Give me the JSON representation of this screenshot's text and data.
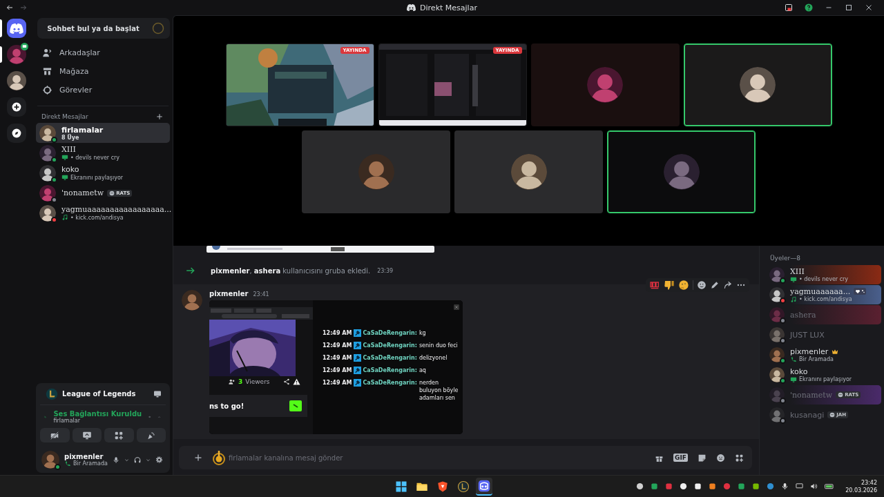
{
  "window": {
    "title": "Direkt Mesajlar"
  },
  "servers": [
    {
      "kind": "home",
      "selected": true,
      "unread": false,
      "in_call": false
    },
    {
      "kind": "avatar",
      "selected": false,
      "unread": true,
      "in_call": true
    },
    {
      "kind": "avatar",
      "selected": false,
      "unread": false,
      "in_call": false
    },
    {
      "kind": "add"
    },
    {
      "kind": "explore"
    }
  ],
  "dm_sidebar": {
    "search": "Sohbet bul ya da başlat",
    "nav": [
      {
        "kind": "friends",
        "label": "Arkadaşlar"
      },
      {
        "kind": "store",
        "label": "Mağaza"
      },
      {
        "kind": "quests",
        "label": "Görevler"
      }
    ],
    "section": "Direkt Mesajlar",
    "dms": [
      {
        "name": "firlamalar",
        "fancy": false,
        "sub": {
          "kind": "plain",
          "text": "8 Üye"
        },
        "selected": true,
        "color": "#23a55a"
      },
      {
        "name": "XIII",
        "fancy": true,
        "sub": {
          "kind": "screen",
          "text": "• devils never cry"
        },
        "selected": false,
        "color": "#23a55a"
      },
      {
        "name": "koko",
        "fancy": false,
        "sub": {
          "kind": "screen",
          "text": "Ekranını paylaşıyor"
        },
        "selected": false,
        "color": "#23a55a"
      },
      {
        "name": "'nonametw",
        "fancy": true,
        "tag": "RATS",
        "selected": false,
        "color": "#80848e"
      },
      {
        "name": "yagmuaaaaaaaaaaaaaaaaa...",
        "fancy": true,
        "sub": {
          "kind": "music",
          "text": "• kick.com/andisya"
        },
        "selected": false,
        "color": "#f23f43"
      }
    ]
  },
  "user_panel": {
    "activity": "League of Legends",
    "voice_status": "Ses Bağlantısı Kuruldu",
    "voice_channel": "firlamalar",
    "user": "pixmenler",
    "user_status": "Bir Aramada"
  },
  "call": {
    "rows": [
      [
        {
          "kind": "stream",
          "badge": "YAYINDA",
          "speaking": false
        },
        {
          "kind": "desktop",
          "badge": "YAYINDA",
          "speaking": false
        },
        {
          "kind": "avatar",
          "speaking": false
        },
        {
          "kind": "avatar",
          "speaking": true
        }
      ],
      [
        {
          "kind": "avatar",
          "speaking": false
        },
        {
          "kind": "avatar",
          "speaking": false
        },
        {
          "kind": "avatar",
          "speaking": true
        }
      ]
    ]
  },
  "chat": {
    "system": {
      "text": "**pixmenler**, **ashera** kullanıcısını gruba ekledi.",
      "time": "23:39"
    },
    "message": {
      "author": "pixmenler",
      "time": "23:41",
      "attachment": {
        "viewers_count": "3",
        "viewers_label": "Viewers",
        "banner": "ns to go!",
        "lines": [
          {
            "time": "12:49 AM",
            "user": "CaSaDeRengarin:",
            "text": "kg"
          },
          {
            "time": "12:49 AM",
            "user": "CaSaDeRengarin:",
            "text": "senin duo feci"
          },
          {
            "time": "12:49 AM",
            "user": "CaSaDeRengarin:",
            "text": "delizyonel"
          },
          {
            "time": "12:49 AM",
            "user": "CaSaDeRengarin:",
            "text": "aq"
          },
          {
            "time": "12:49 AM",
            "user": "CaSaDeRengarin:",
            "text": "nerden buluyon böyle adamları sen"
          }
        ]
      }
    },
    "composer": {
      "placeholder": "firlamalar kanalına mesaj gönder",
      "gif": "GIF"
    }
  },
  "members": {
    "header": "Üyeler—8",
    "list": [
      {
        "name": "XIII",
        "fancy": true,
        "sub": {
          "kind": "screen",
          "text": "• devils never cry"
        },
        "color": "#23a55a",
        "banner": {
          "color": "#8a2a14"
        },
        "dim": false
      },
      {
        "name": "yagmuaaaaaa...",
        "fancy": true,
        "sub": {
          "kind": "music",
          "text": "• kick.com/andisya"
        },
        "color": "#f23f43",
        "banner": {
          "color": "#4a5f8c"
        },
        "dim": false,
        "badge": true
      },
      {
        "name": "ashera",
        "fancy": true,
        "color": "#80848e",
        "banner": {
          "color": "#5a2030"
        },
        "dim": true
      },
      {
        "name": "JUST LUX",
        "fancy": false,
        "color": "#80848e",
        "dim": true
      },
      {
        "name": "pixmenler",
        "fancy": false,
        "owner": true,
        "sub": {
          "kind": "call",
          "text": "Bir Aramada"
        },
        "color": "#23a55a",
        "dim": false
      },
      {
        "name": "koko",
        "fancy": false,
        "sub": {
          "kind": "screen",
          "text": "Ekranını paylaşıyor"
        },
        "color": "#23a55a",
        "dim": false
      },
      {
        "name": "'nonametw",
        "fancy": true,
        "tag": "RATS",
        "color": "#80848e",
        "banner": {
          "color": "#4a2a6a"
        },
        "dim": true
      },
      {
        "name": "kusanagi",
        "fancy": false,
        "tag": "JAH",
        "color": "#80848e",
        "dim": true
      }
    ]
  },
  "taskbar": {
    "time": "23:42",
    "date": "20.03.2026"
  }
}
